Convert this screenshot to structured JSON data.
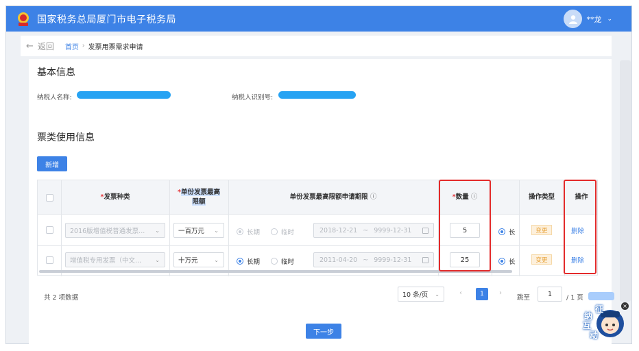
{
  "header": {
    "title": "国家税务总局厦门市电子税务局",
    "user_name": "**龙"
  },
  "breadcrumb": {
    "back_label": "返回",
    "home": "首页",
    "separator": "›",
    "current": "发票用票需求申请"
  },
  "basic_info": {
    "section_title": "基本信息",
    "taxpayer_name_label": "纳税人名称:",
    "taxpayer_id_label": "纳税人识别号:"
  },
  "ticket_usage": {
    "section_title": "票类使用信息",
    "add_button": "新增",
    "columns": {
      "invoice_type": "发票种类",
      "max_amount_line1": "单份发票最高",
      "max_amount_line2": "限额",
      "period": "单份发票最高限额申请期限",
      "quantity": "数量",
      "op_type": "操作类型",
      "action": "操作"
    },
    "required_mark": "*",
    "info_glyph": "ⓘ",
    "rows": [
      {
        "invoice_type": "2016版增值税普通发票...",
        "max_amount": "一百万元",
        "radio_long": "长期",
        "radio_temp": "临时",
        "date_start": "2018-12-21",
        "date_sep": "~",
        "date_end": "9999-12-31",
        "quantity": "5",
        "extra_radio_label": "长",
        "op_type": "变更",
        "action": "删除",
        "disabled": true
      },
      {
        "invoice_type": "增值税专用发票（中文...",
        "max_amount": "十万元",
        "radio_long": "长期",
        "radio_temp": "临时",
        "date_start": "2011-04-20",
        "date_sep": "~",
        "date_end": "9999-12-31",
        "quantity": "25",
        "extra_radio_label": "长",
        "op_type": "变更",
        "action": "删除",
        "disabled": false
      }
    ]
  },
  "pagination": {
    "total_text": "共 2 项数据",
    "page_size": "10 条/页",
    "prev": "‹",
    "current_page": "1",
    "next": "›",
    "jump_label": "跳至",
    "jump_value": "1",
    "total_pages": "/ 1 页"
  },
  "next_button": "下一步",
  "assistant": {
    "line1": "征",
    "line2": "纳",
    "line3": "互",
    "line4": "动"
  },
  "colors": {
    "primary": "#3d82e6",
    "highlight_box": "#e32a2a",
    "required": "#e4393c",
    "tag_text": "#e8a33a"
  }
}
